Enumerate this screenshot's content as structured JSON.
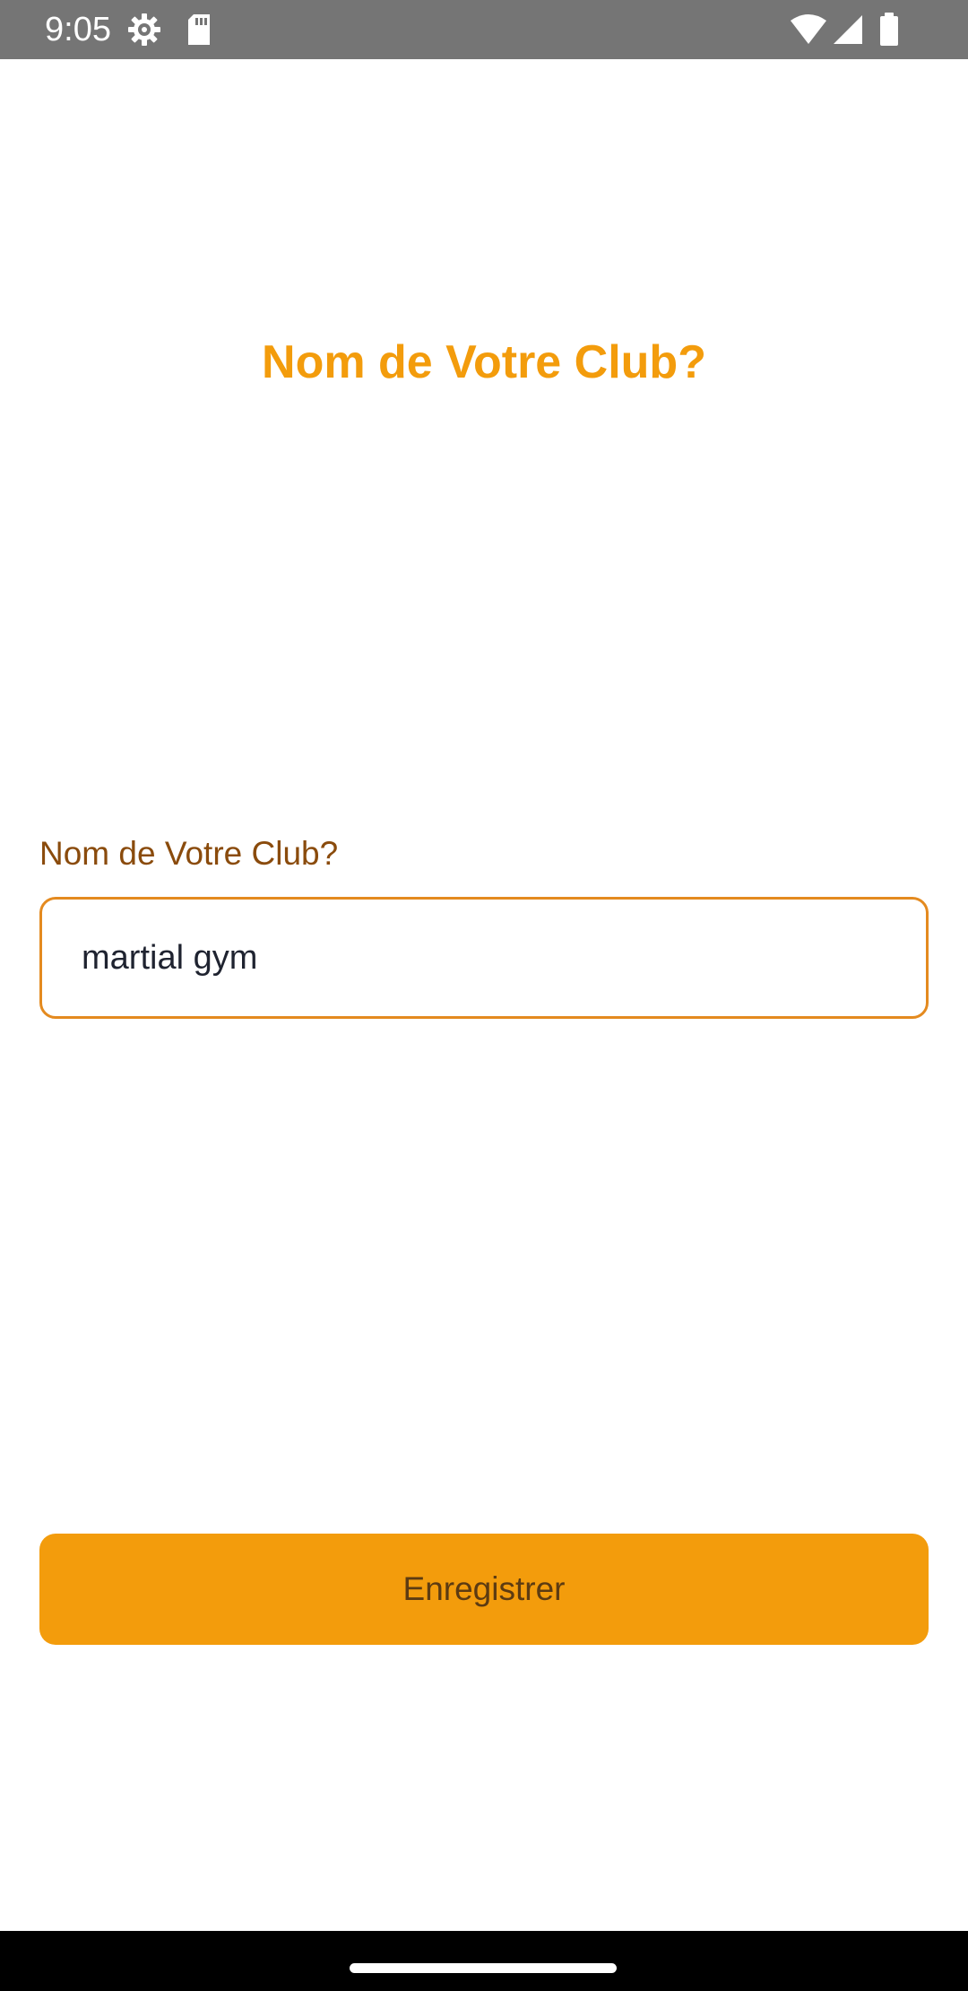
{
  "status_bar": {
    "time": "9:05",
    "icons": {
      "left": [
        "settings-gear-icon",
        "sd-card-icon"
      ],
      "right": [
        "wifi-icon",
        "cell-signal-icon",
        "battery-icon"
      ]
    }
  },
  "screen": {
    "title": "Nom de Votre Club?"
  },
  "form": {
    "club_name_label": "Nom de Votre Club?",
    "club_name_value": "martial gym"
  },
  "actions": {
    "save_label": "Enregistrer"
  },
  "colors": {
    "accent": "#f39c0c",
    "label": "#8a4b0c",
    "field_border": "#e48a1f",
    "button_text": "#5c3b12",
    "status_bar": "#757575",
    "nav_bar": "#000000"
  }
}
